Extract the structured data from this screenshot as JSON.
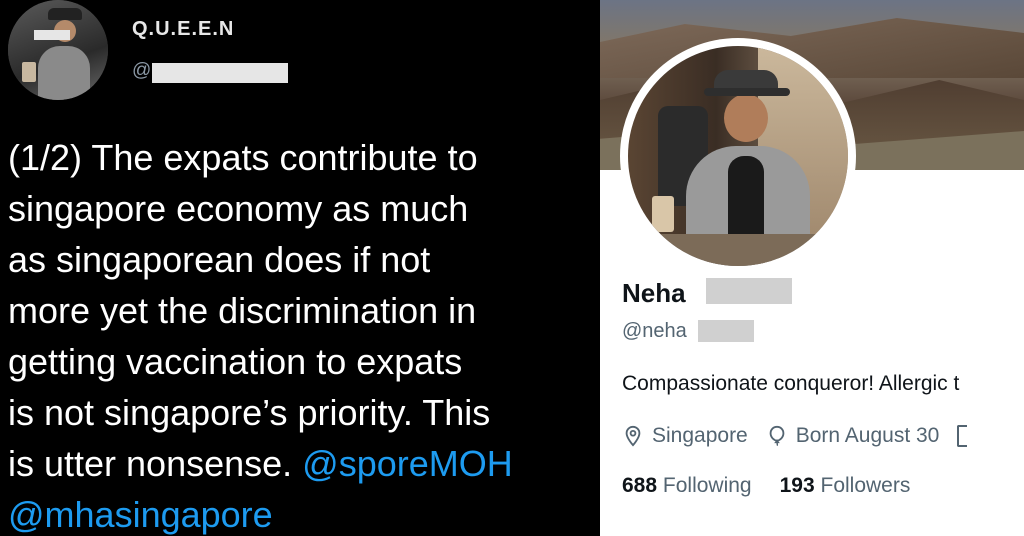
{
  "tweet": {
    "display_name": "Q.U.E.E.N",
    "handle_prefix": "@",
    "text_lines": [
      "(1/2) The expats contribute to",
      "singapore economy as much",
      "as singaporean does if not",
      "more yet the discrimination in",
      "getting vaccination to expats",
      "is not singapore’s priority. This"
    ],
    "last_line_text": "is utter nonsense. ",
    "mention_1": "@sporeMOH",
    "mention_2": "@mhasingapore"
  },
  "profile": {
    "name": "Neha",
    "handle": "@neha",
    "bio": "Compassionate conqueror! Allergic t",
    "location": "Singapore",
    "birthday": "Born August 30",
    "following_count": "688",
    "following_label": "Following",
    "followers_count": "193",
    "followers_label": "Followers"
  },
  "colors": {
    "mention_blue": "#1d9bf0",
    "dark_bg": "#000000",
    "light_bg": "#ffffff",
    "muted_text": "#536471"
  }
}
